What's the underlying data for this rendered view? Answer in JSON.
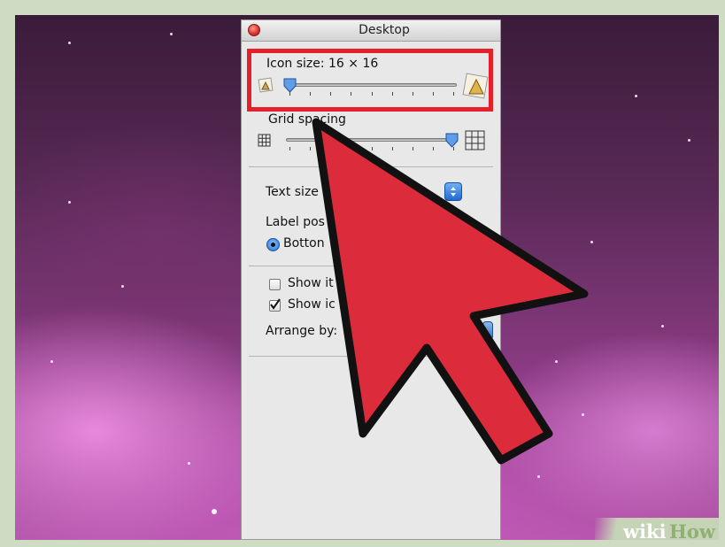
{
  "window": {
    "title": "Desktop"
  },
  "icon_size": {
    "label": "Icon size: 16 × 16",
    "level": 0.0
  },
  "grid_spacing": {
    "label": "Grid spacing",
    "level": 1.0
  },
  "text_size": {
    "label": "Text size"
  },
  "label_position": {
    "label": "Label pos",
    "option": "Botton"
  },
  "options": {
    "show_item_info": {
      "label": "Show it",
      "checked": false
    },
    "show_icon_preview": {
      "label": "Show ic",
      "checked": true
    }
  },
  "arrange_by": {
    "label": "Arrange by:"
  },
  "watermark": {
    "wiki": "wiki",
    "how": "How"
  },
  "colors": {
    "highlight": "#e5202a",
    "arrow_fill": "#dc2b3a",
    "accent_blue": "#2c74d6"
  },
  "icons": [
    "close-icon",
    "small-icon-preview",
    "large-icon-preview",
    "small-grid-icon",
    "large-grid-icon",
    "popup-stepper-icon",
    "red-pointer-arrow"
  ]
}
